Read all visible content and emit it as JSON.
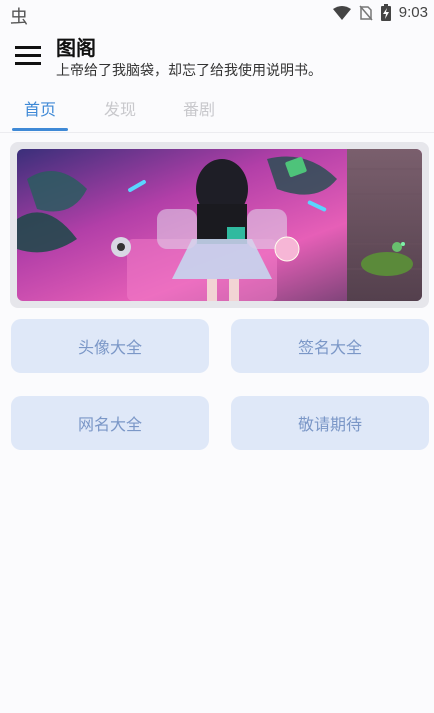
{
  "status_bar": {
    "left_icon": "bug-icon",
    "left_glyph": "虫",
    "time": "9:03",
    "icons": [
      "wifi-icon",
      "no-sim-icon",
      "battery-charging-icon"
    ]
  },
  "app_bar": {
    "menu_icon": "menu-icon",
    "title": "图阁",
    "subtitle": "上帝给了我脑袋，却忘了给我使用说明书。"
  },
  "tabs": [
    {
      "label": "首页",
      "active": true
    },
    {
      "label": "发现",
      "active": false
    },
    {
      "label": "番剧",
      "active": false
    }
  ],
  "colors": {
    "accent": "#3f89d6",
    "tile_bg": "#dfe8f8",
    "tile_text": "#7b97c7"
  },
  "tiles": [
    {
      "label": "头像大全"
    },
    {
      "label": "签名大全"
    },
    {
      "label": "网名大全"
    },
    {
      "label": "敬请期待"
    }
  ]
}
